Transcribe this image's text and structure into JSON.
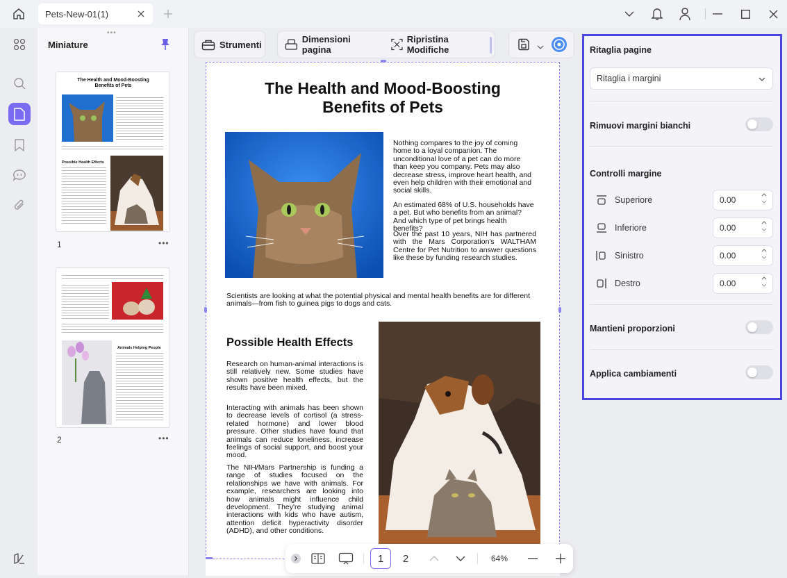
{
  "titlebar": {
    "tab_title": "Pets-New-01(1)"
  },
  "thumbnails": {
    "title": "Miniature",
    "pages": [
      {
        "number": "1"
      },
      {
        "number": "2"
      }
    ],
    "thumb1": {
      "title": "The Health and Mood-Boosting Benefits of Pets",
      "heading": "Possible Health Effects"
    },
    "thumb2": {
      "heading": "Animals Helping People"
    }
  },
  "toolbar": {
    "tools_label": "Strumenti",
    "page_size_label": "Dimensioni pagina",
    "reset_label": "Ripristina Modifiche"
  },
  "document": {
    "title_line1": "The Health and Mood-Boosting",
    "title_line2": "Benefits of Pets",
    "p1": "Nothing compares to the joy of coming home to a loyal companion. The unconditional love of a pet can do more than keep you company. Pets may also decrease stress, improve heart health, and even help children with their emotional and social skills.",
    "p2": "An estimated 68% of U.S. households have a pet. But who benefits from an animal? And which type of pet brings health benefits?",
    "p3": "Over the past 10 years, NIH has partnered with the Mars Corporation's WALTHAM Centre for Pet Nutrition to answer questions like these by funding research studies.",
    "p4": "Scientists are looking at what the potential physical and mental health benefits are for different animals—from fish to guinea pigs to dogs and cats.",
    "heading2": "Possible Health Effects",
    "p5": "Research on human-animal interactions is still relatively new. Some studies have shown positive health effects, but the results have been mixed.",
    "p6": "Interacting with animals has been shown to decrease levels of cortisol (a stress-related hormone) and lower blood pressure. Other studies have found that animals can reduce loneliness, increase feelings of social support, and boost your mood.",
    "p7": "The NIH/Mars Partnership is funding a range of studies focused on the relationships we have with animals. For example, researchers are looking into how animals might influence child development. They're studying animal interactions with kids who have autism, attention deficit hyperactivity disorder (ADHD), and other conditions."
  },
  "bottombar": {
    "page1": "1",
    "page2": "2",
    "zoom": "64%"
  },
  "crop_panel": {
    "title": "Ritaglia pagine",
    "mode_value": "Ritaglia i margini",
    "remove_white_label": "Rimuovi margini bianchi",
    "margins_title": "Controlli margine",
    "margins": [
      {
        "label": "Superiore",
        "value": "0.00"
      },
      {
        "label": "Inferiore",
        "value": "0.00"
      },
      {
        "label": "Sinistro",
        "value": "0.00"
      },
      {
        "label": "Destro",
        "value": "0.00"
      }
    ],
    "keep_ratio_label": "Mantieni proporzioni",
    "apply_label": "Applica cambiamenti"
  },
  "colors": {
    "accent": "#7a6cf0",
    "panel_border": "#4a45dd"
  }
}
